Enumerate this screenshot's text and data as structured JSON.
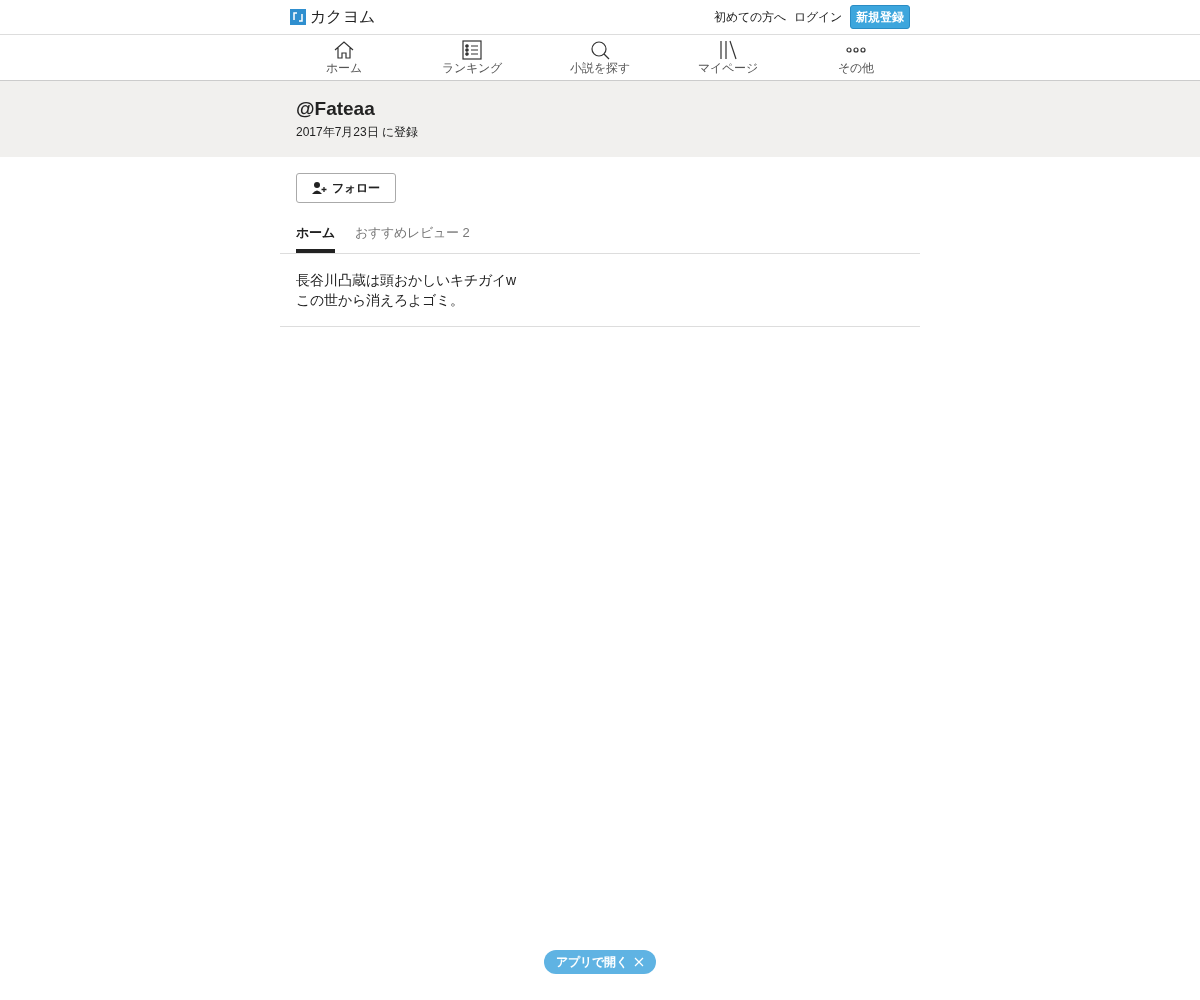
{
  "header": {
    "logo": "カクヨム",
    "links": [
      "初めての方へ",
      "ログイン"
    ],
    "signup": "新規登録"
  },
  "nav": [
    {
      "kind": "home",
      "label": "ホーム"
    },
    {
      "kind": "ranking",
      "label": "ランキング"
    },
    {
      "kind": "search",
      "label": "小説を探す"
    },
    {
      "kind": "library",
      "label": "マイページ"
    },
    {
      "kind": "more",
      "label": "その他"
    }
  ],
  "profile": {
    "name": "@Fateaa",
    "registered": "2017年7月23日 に登録"
  },
  "follow_button": "フォロー",
  "tabs": [
    {
      "label": "ホーム",
      "selected": true
    },
    {
      "label": "おすすめレビュー",
      "count": "2",
      "selected": false
    }
  ],
  "intro": [
    "長谷川凸蔵は頭おかしいキチガイw",
    "この世から消えろよゴミ。"
  ],
  "app_banner": {
    "label": "アプリで開く"
  }
}
